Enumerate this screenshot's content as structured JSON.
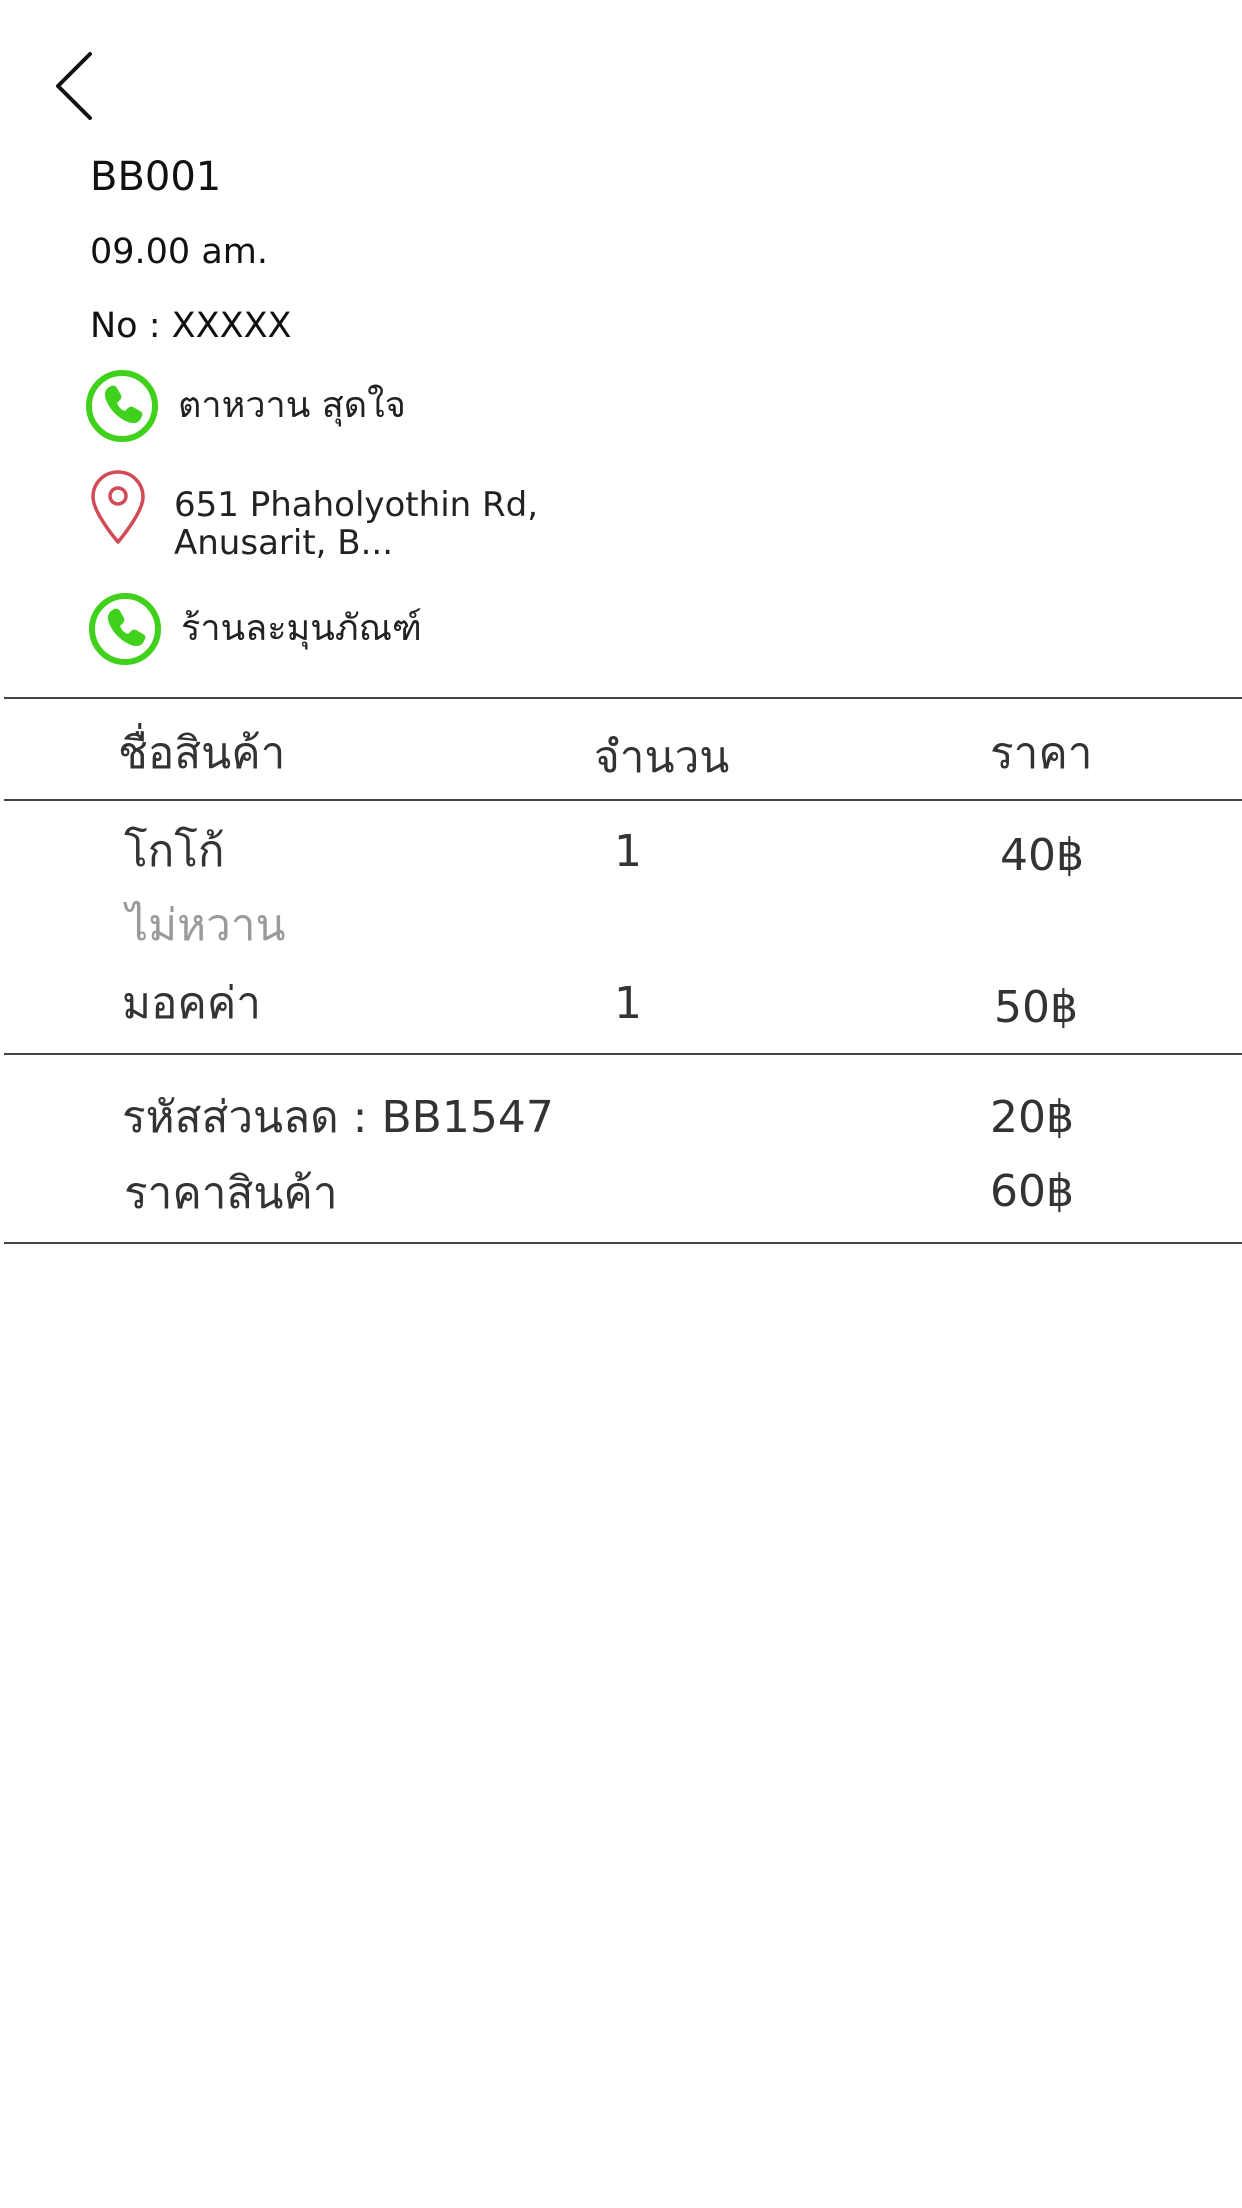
{
  "header": {
    "order_code": "BB001",
    "time": "09.00 am.",
    "order_no": "No : XXXXX"
  },
  "customer": {
    "name": "ตาหวาน สุดใจ",
    "icon": "phone-icon",
    "icon_color": "#3fd11c"
  },
  "address": {
    "line1": "651 Phaholyothin Rd,",
    "line2": "Anusarit, B...",
    "icon": "location-pin-icon",
    "icon_color": "#d24a55"
  },
  "shop": {
    "name": "ร้านละมุนภัณฑ์",
    "icon": "phone-icon"
  },
  "table": {
    "headers": {
      "name": "ชื่อสินค้า",
      "qty": "จำนวน",
      "price": "ราคา"
    },
    "rows": [
      {
        "name": "โกโก้",
        "note": "ไม่หวาน",
        "qty": "1",
        "price": "40฿"
      },
      {
        "name": "มอคค่า",
        "qty": "1",
        "price": "50฿"
      }
    ]
  },
  "summary": {
    "discount_label": "รหัสส่วนลด : BB1547",
    "discount_value": "20฿",
    "subtotal_label": "ราคาสินค้า",
    "subtotal_value": "60฿"
  }
}
